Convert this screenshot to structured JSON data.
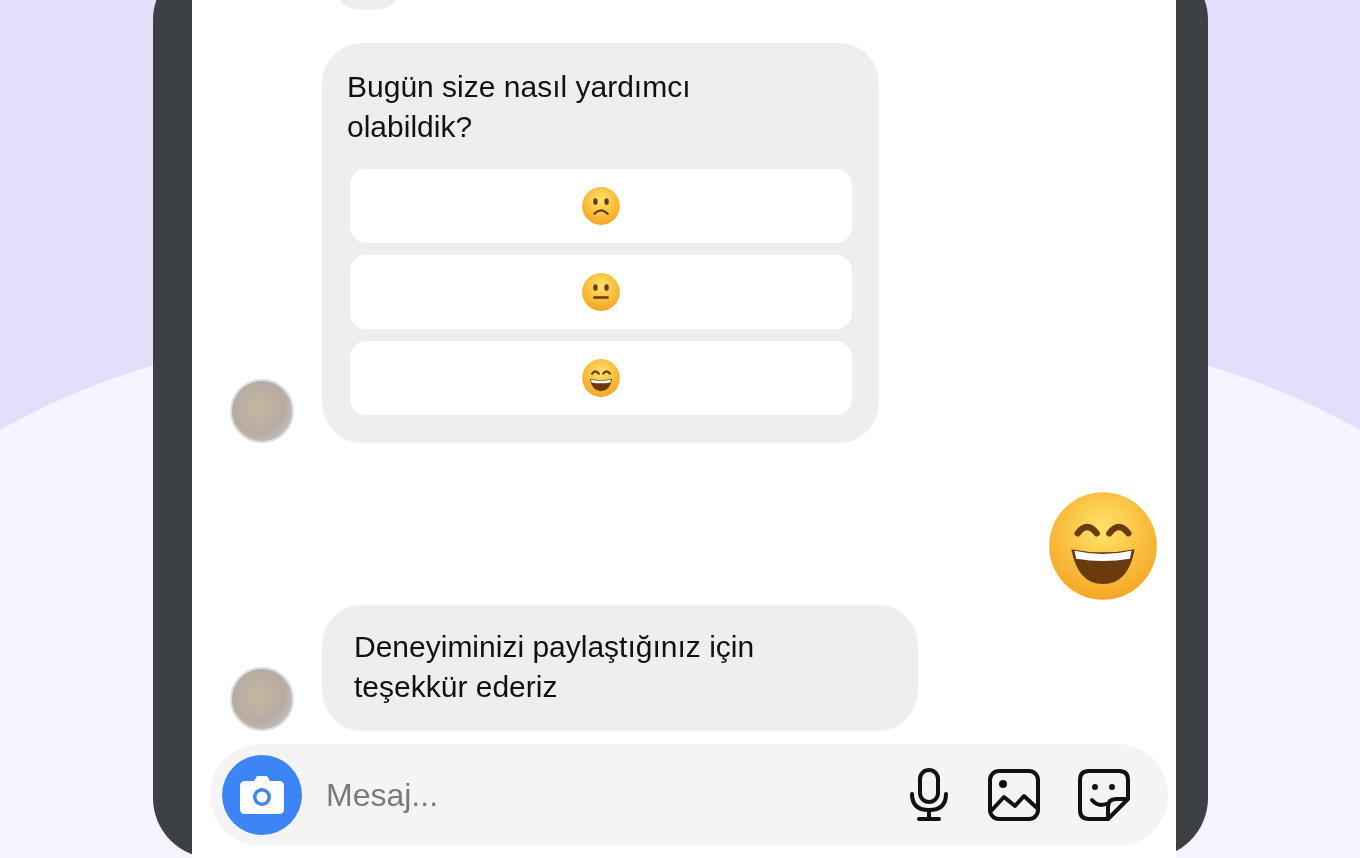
{
  "chat": {
    "survey": {
      "question": "Bugün size nasıl yardımcı olabildik?",
      "options": [
        {
          "kind": "sad"
        },
        {
          "kind": "neutral"
        },
        {
          "kind": "happy"
        }
      ]
    },
    "reply": {
      "kind": "happy"
    },
    "thanks": "Deneyiminizi paylaştığınız için teşekkür ederiz"
  },
  "composer": {
    "placeholder": "Mesaj..."
  }
}
